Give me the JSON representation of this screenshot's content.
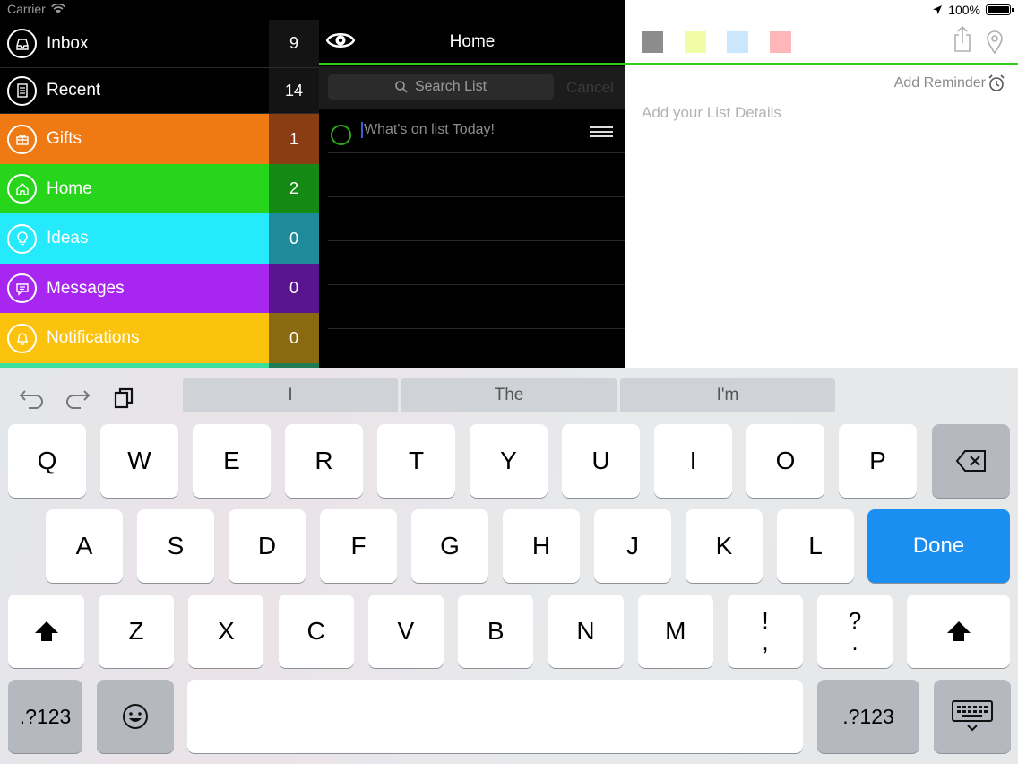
{
  "status_bar": {
    "carrier": "Carrier",
    "battery": "100%"
  },
  "sidebar": {
    "items": [
      {
        "label": "Inbox",
        "count": "9",
        "bg": "#000000",
        "count_bg": "#141414",
        "icon": "inbox-icon"
      },
      {
        "label": "Recent",
        "count": "14",
        "bg": "#000000",
        "count_bg": "#141414",
        "icon": "document-icon"
      },
      {
        "label": "Gifts",
        "count": "1",
        "bg": "#ef7a14",
        "count_bg": "#8a3c12",
        "icon": "gift-icon"
      },
      {
        "label": "Home",
        "count": "2",
        "bg": "#27d51a",
        "count_bg": "#148a14",
        "icon": "home-icon"
      },
      {
        "label": "Ideas",
        "count": "0",
        "bg": "#25eafc",
        "count_bg": "#1e8a9a",
        "icon": "lightbulb-icon"
      },
      {
        "label": "Messages",
        "count": "0",
        "bg": "#a827f0",
        "count_bg": "#5b1490",
        "icon": "chat-icon"
      },
      {
        "label": "Notifications",
        "count": "0",
        "bg": "#fbc20e",
        "count_bg": "#8a6a10",
        "icon": "bell-icon"
      }
    ],
    "peek_color": "#3ce09c"
  },
  "list_panel": {
    "title": "Home",
    "search_placeholder": "Search List",
    "cancel_label": "Cancel",
    "new_item_placeholder": "What's on list Today!"
  },
  "detail_panel": {
    "swatches": [
      "#8c8c8c",
      "#f0fca6",
      "#cbe7fd",
      "#fdb7b8"
    ],
    "add_reminder_label": "Add Reminder",
    "details_placeholder": "Add your List Details"
  },
  "keyboard": {
    "suggestions": [
      "I",
      "The",
      "I'm"
    ],
    "row1": [
      "Q",
      "W",
      "E",
      "R",
      "T",
      "Y",
      "U",
      "I",
      "O",
      "P"
    ],
    "row2": [
      "A",
      "S",
      "D",
      "F",
      "G",
      "H",
      "J",
      "K",
      "L"
    ],
    "row3": [
      "Z",
      "X",
      "C",
      "V",
      "B",
      "N",
      "M"
    ],
    "punct1": [
      "!",
      ","
    ],
    "punct2": [
      "?",
      "."
    ],
    "done_label": "Done",
    "numbers_label": ".?123",
    "accent": "#1b8ef2"
  }
}
